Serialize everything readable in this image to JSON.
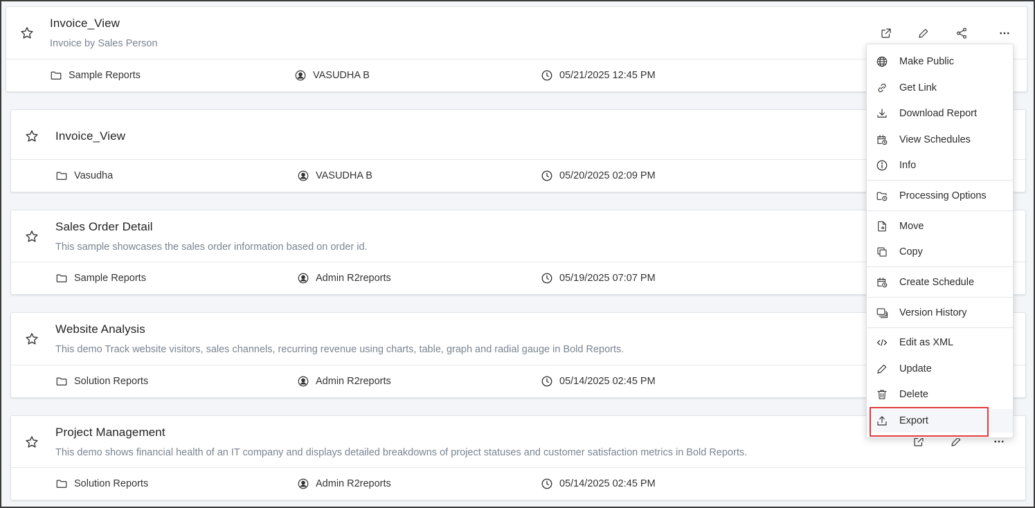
{
  "reports": [
    {
      "title": "Invoice_View",
      "description": "Invoice by Sales Person",
      "folder": "Sample Reports",
      "owner": "VASUDHA B",
      "modified": "05/21/2025 12:45 PM"
    },
    {
      "title": "Invoice_View",
      "description": "",
      "folder": "Vasudha",
      "owner": "VASUDHA B",
      "modified": "05/20/2025 02:09 PM"
    },
    {
      "title": "Sales Order Detail",
      "description": "This sample showcases the sales order information based on order id.",
      "folder": "Sample Reports",
      "owner": "Admin R2reports",
      "modified": "05/19/2025 07:07 PM"
    },
    {
      "title": "Website Analysis",
      "description": "This demo Track website visitors, sales channels, recurring revenue using charts, table, graph and radial gauge in Bold Reports.",
      "folder": "Solution Reports",
      "owner": "Admin R2reports",
      "modified": "05/14/2025 02:45 PM"
    },
    {
      "title": "Project Management",
      "description": "This demo shows financial health of an IT company and displays detailed breakdowns of project statuses and customer satisfaction metrics in Bold Reports.",
      "folder": "Solution Reports",
      "owner": "Admin R2reports",
      "modified": "05/14/2025 02:45 PM"
    }
  ],
  "menu": {
    "items": [
      {
        "label": "Make Public",
        "icon": "globe-icon"
      },
      {
        "label": "Get Link",
        "icon": "link-icon"
      },
      {
        "label": "Download Report",
        "icon": "download-icon"
      },
      {
        "label": "View Schedules",
        "icon": "calendar-clock-icon"
      },
      {
        "label": "Info",
        "icon": "info-icon"
      },
      {
        "label": "Processing Options",
        "icon": "folder-clock-icon"
      },
      {
        "label": "Move",
        "icon": "move-file-icon"
      },
      {
        "label": "Copy",
        "icon": "copy-icon"
      },
      {
        "label": "Create Schedule",
        "icon": "calendar-clock-icon"
      },
      {
        "label": "Version History",
        "icon": "version-history-icon"
      },
      {
        "label": "Edit as XML",
        "icon": "code-icon"
      },
      {
        "label": "Update",
        "icon": "pencil-icon"
      },
      {
        "label": "Delete",
        "icon": "trash-icon"
      },
      {
        "label": "Export",
        "icon": "export-icon"
      }
    ],
    "highlighted": "Export"
  },
  "colors": {
    "highlight_border": "#e03b3b",
    "description_text": "#7a8591",
    "page_background": "#f3f5f8"
  }
}
